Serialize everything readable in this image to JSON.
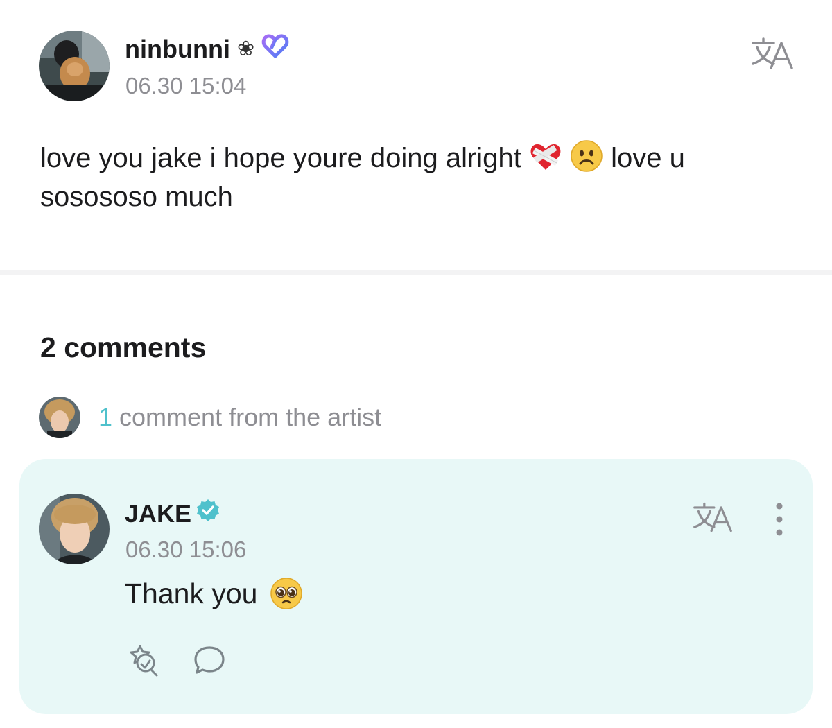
{
  "post": {
    "username": "ninbunni",
    "flower_symbol": "❀",
    "timestamp": "06.30 15:04",
    "body_part1": "love you jake i hope youre doing alright",
    "body_part2": "love u sosososo much",
    "emojis": [
      "mending-heart",
      "frowning-face"
    ]
  },
  "comments": {
    "count_label": "2 comments",
    "artist_count": "1",
    "artist_label": "comment from the artist"
  },
  "artist_comment": {
    "name": "JAKE",
    "timestamp": "06.30 15:06",
    "text": "Thank you",
    "emoji": "pleading-face"
  },
  "icons": [
    "translate-icon",
    "more-vertical-icon",
    "react-icon",
    "reply-icon",
    "verified-badge-icon",
    "membership-heart-icon"
  ],
  "colors": {
    "accent_teal": "#4fc1cc",
    "card_background": "#e8f8f7",
    "secondary_text": "#8e8e93",
    "divider": "#f3f3f4"
  }
}
